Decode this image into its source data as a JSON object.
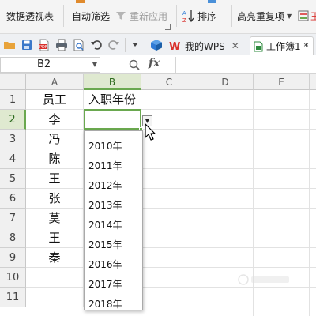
{
  "ribbon": {
    "pivot_table": "数据透视表",
    "auto_filter": "自动筛选",
    "reapply": "重新应用",
    "sort": "排序",
    "highlight_duplicates": "高亮重复项",
    "partial_label": "王"
  },
  "quickbar": {
    "my_wps_tab": "我的WPS",
    "workbook_tab": "工作簿1 *"
  },
  "formula_bar": {
    "name_box": "B2",
    "fx": "fx",
    "formula": ""
  },
  "sheet": {
    "columns": [
      "A",
      "B",
      "C",
      "D",
      "E"
    ],
    "rows": [
      "1",
      "2",
      "3",
      "4",
      "5",
      "6",
      "7",
      "8",
      "9",
      "10",
      "11"
    ],
    "header_b1": "入职年份",
    "names": [
      "员工",
      "李",
      "冯",
      "陈",
      "王",
      "张",
      "莫",
      "王",
      "秦"
    ],
    "selected_cell": "B2"
  },
  "dropdown": {
    "options": [
      "2010年",
      "2011年",
      "2012年",
      "2013年",
      "2014年",
      "2015年",
      "2016年",
      "2017年",
      "2018年"
    ]
  },
  "colors": {
    "selection": "#6aa84f",
    "wps_red": "#d9302c",
    "accent_blue": "#2f7bd6"
  },
  "icons": [
    "pivot-table-icon",
    "filter-icon",
    "reapply-icon",
    "sort-icon",
    "highlight-icon",
    "folder-icon",
    "save-icon",
    "pdf-icon",
    "print-icon",
    "print-preview-icon",
    "undo-icon",
    "redo-icon",
    "wps-logo-icon",
    "workbook-icon",
    "zoom-icon",
    "cursor-icon"
  ]
}
